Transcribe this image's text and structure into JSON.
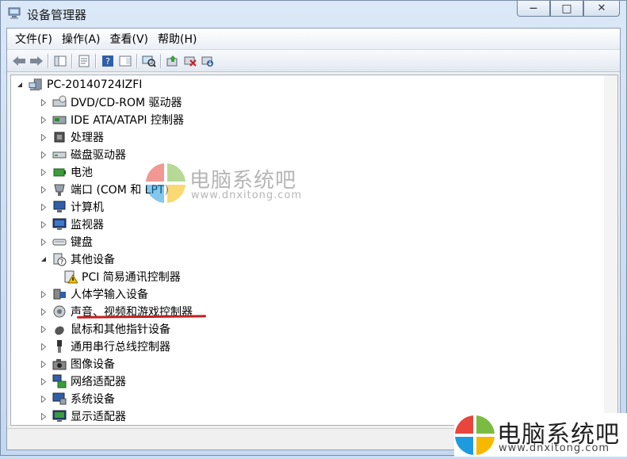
{
  "window": {
    "title": "设备管理器",
    "min_glyph": "—",
    "max_glyph": "□",
    "close_glyph": "✕"
  },
  "menu": [
    "文件(F)",
    "操作(A)",
    "查看(V)",
    "帮助(H)"
  ],
  "toolbar": [
    "back-icon",
    "forward-icon",
    "sep",
    "console-tree-icon",
    "sep",
    "properties-icon",
    "sep",
    "help-icon",
    "show-view-icon",
    "sep",
    "scan-hardware-icon",
    "sep",
    "update-driver-icon",
    "disable-device-icon",
    "uninstall-icon"
  ],
  "tree": {
    "root": "PC-20140724IZFI",
    "items": [
      {
        "label": "DVD/CD-ROM 驱动器",
        "icon": "dvd-drive-icon",
        "expanded": false
      },
      {
        "label": "IDE ATA/ATAPI 控制器",
        "icon": "ide-controller-icon",
        "expanded": false
      },
      {
        "label": "处理器",
        "icon": "processor-icon",
        "expanded": false
      },
      {
        "label": "磁盘驱动器",
        "icon": "disk-drive-icon",
        "expanded": false
      },
      {
        "label": "电池",
        "icon": "battery-icon",
        "expanded": false
      },
      {
        "label": "端口 (COM 和 LPT)",
        "icon": "port-icon",
        "expanded": false
      },
      {
        "label": "计算机",
        "icon": "computer-icon",
        "expanded": false
      },
      {
        "label": "监视器",
        "icon": "monitor-icon",
        "expanded": false
      },
      {
        "label": "键盘",
        "icon": "keyboard-icon",
        "expanded": false
      },
      {
        "label": "其他设备",
        "icon": "other-devices-icon",
        "expanded": true
      },
      {
        "label": "PCI 简易通讯控制器",
        "icon": "warning-device-icon",
        "child": true
      },
      {
        "label": "人体学输入设备",
        "icon": "hid-icon",
        "expanded": false
      },
      {
        "label": "声音、视频和游戏控制器",
        "icon": "sound-icon",
        "expanded": false
      },
      {
        "label": "鼠标和其他指针设备",
        "icon": "mouse-icon",
        "expanded": false
      },
      {
        "label": "通用串行总线控制器",
        "icon": "usb-icon",
        "expanded": false
      },
      {
        "label": "图像设备",
        "icon": "camera-icon",
        "expanded": false
      },
      {
        "label": "网络适配器",
        "icon": "network-adapter-icon",
        "expanded": false
      },
      {
        "label": "系统设备",
        "icon": "system-devices-icon",
        "expanded": false
      },
      {
        "label": "显示适配器",
        "icon": "display-adapter-icon",
        "expanded": false
      }
    ]
  },
  "watermark": {
    "brand": "电脑系统吧",
    "url": "www.dnxitong.com"
  },
  "colors": {
    "highlight_underline": "#c22020",
    "warning": "#f2c200"
  }
}
